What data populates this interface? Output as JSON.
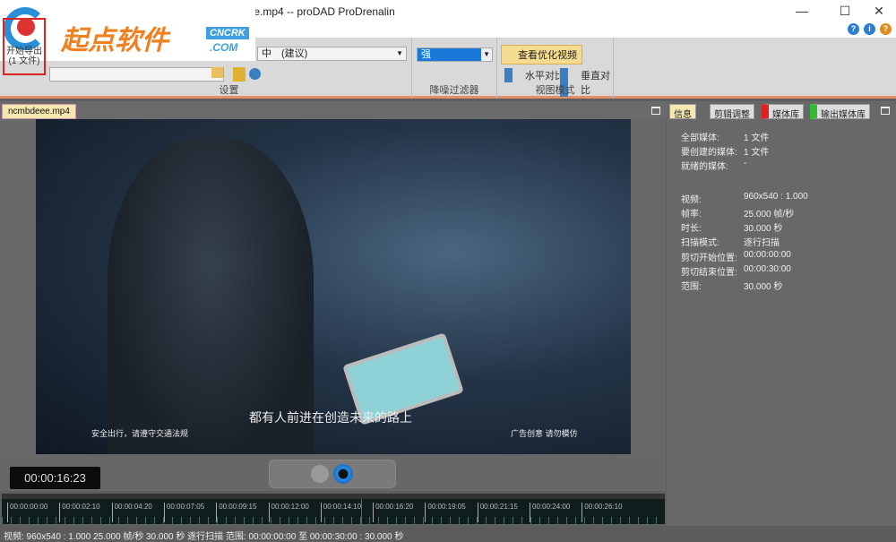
{
  "window": {
    "title": "eee.mp4 -- proDAD ProDrenalin",
    "min": "—",
    "max": "☐",
    "close": "✕",
    "help": "?",
    "info": "i"
  },
  "watermark": {
    "name": "起点软件",
    "cn": "CNCRK",
    "com": ".COM"
  },
  "ribbon": {
    "export_label": "开始导出",
    "export_count": "(1 文件)",
    "quality_value": "中　(建议)",
    "settings_label": "设置",
    "denoise_value": "强",
    "denoise_label": "降噪过滤器",
    "view_optimized": "查看优化视频",
    "horizontal": "水平对比",
    "vertical": "垂直对比",
    "view_mode_label": "视图模式"
  },
  "file_tab": "ncmbdeee.mp4",
  "video": {
    "subtitle": "都有人前进在创造未来的路上",
    "left_caption": "安全出行，请遵守交通法规",
    "right_caption": "广告创意 请勿模仿"
  },
  "player": {
    "timecode": "00:00:16:23"
  },
  "timeline": {
    "ticks": [
      "00:00:00:00",
      "00:00:02:10",
      "00:00:04:20",
      "00:00:07:05",
      "00:00:09:15",
      "00:00:12:00",
      "00:00:14:10",
      "00:00:16:20",
      "00:00:19:05",
      "00:00:21:15",
      "00:00:24:00",
      "00:00:26:10"
    ],
    "playhead_fraction": 0.562
  },
  "status": "视频: 960x540 : 1.000   25.000 帧/秒   30.000 秒   逐行扫描   范围: 00:00:00:00 至 00:00:30:00 : 30.000 秒",
  "panel": {
    "tabs": [
      "信息",
      "剪辑调整",
      "媒体库",
      "输出媒体库"
    ],
    "rows": [
      {
        "k": "全部媒体:",
        "v": "1 文件"
      },
      {
        "k": "要创建的媒体:",
        "v": "1 文件"
      },
      {
        "k": "就绪的媒体:",
        "v": "-"
      },
      {
        "k": "视频:",
        "v": "960x540 : 1.000"
      },
      {
        "k": "帧率:",
        "v": "25.000 帧/秒"
      },
      {
        "k": "时长:",
        "v": "30.000 秒"
      },
      {
        "k": "扫描模式:",
        "v": "逐行扫描"
      },
      {
        "k": "剪切开始位置:",
        "v": "00:00:00:00"
      },
      {
        "k": "剪切结束位置:",
        "v": "00:00:30:00"
      },
      {
        "k": "范围:",
        "v": "30.000 秒"
      }
    ]
  }
}
